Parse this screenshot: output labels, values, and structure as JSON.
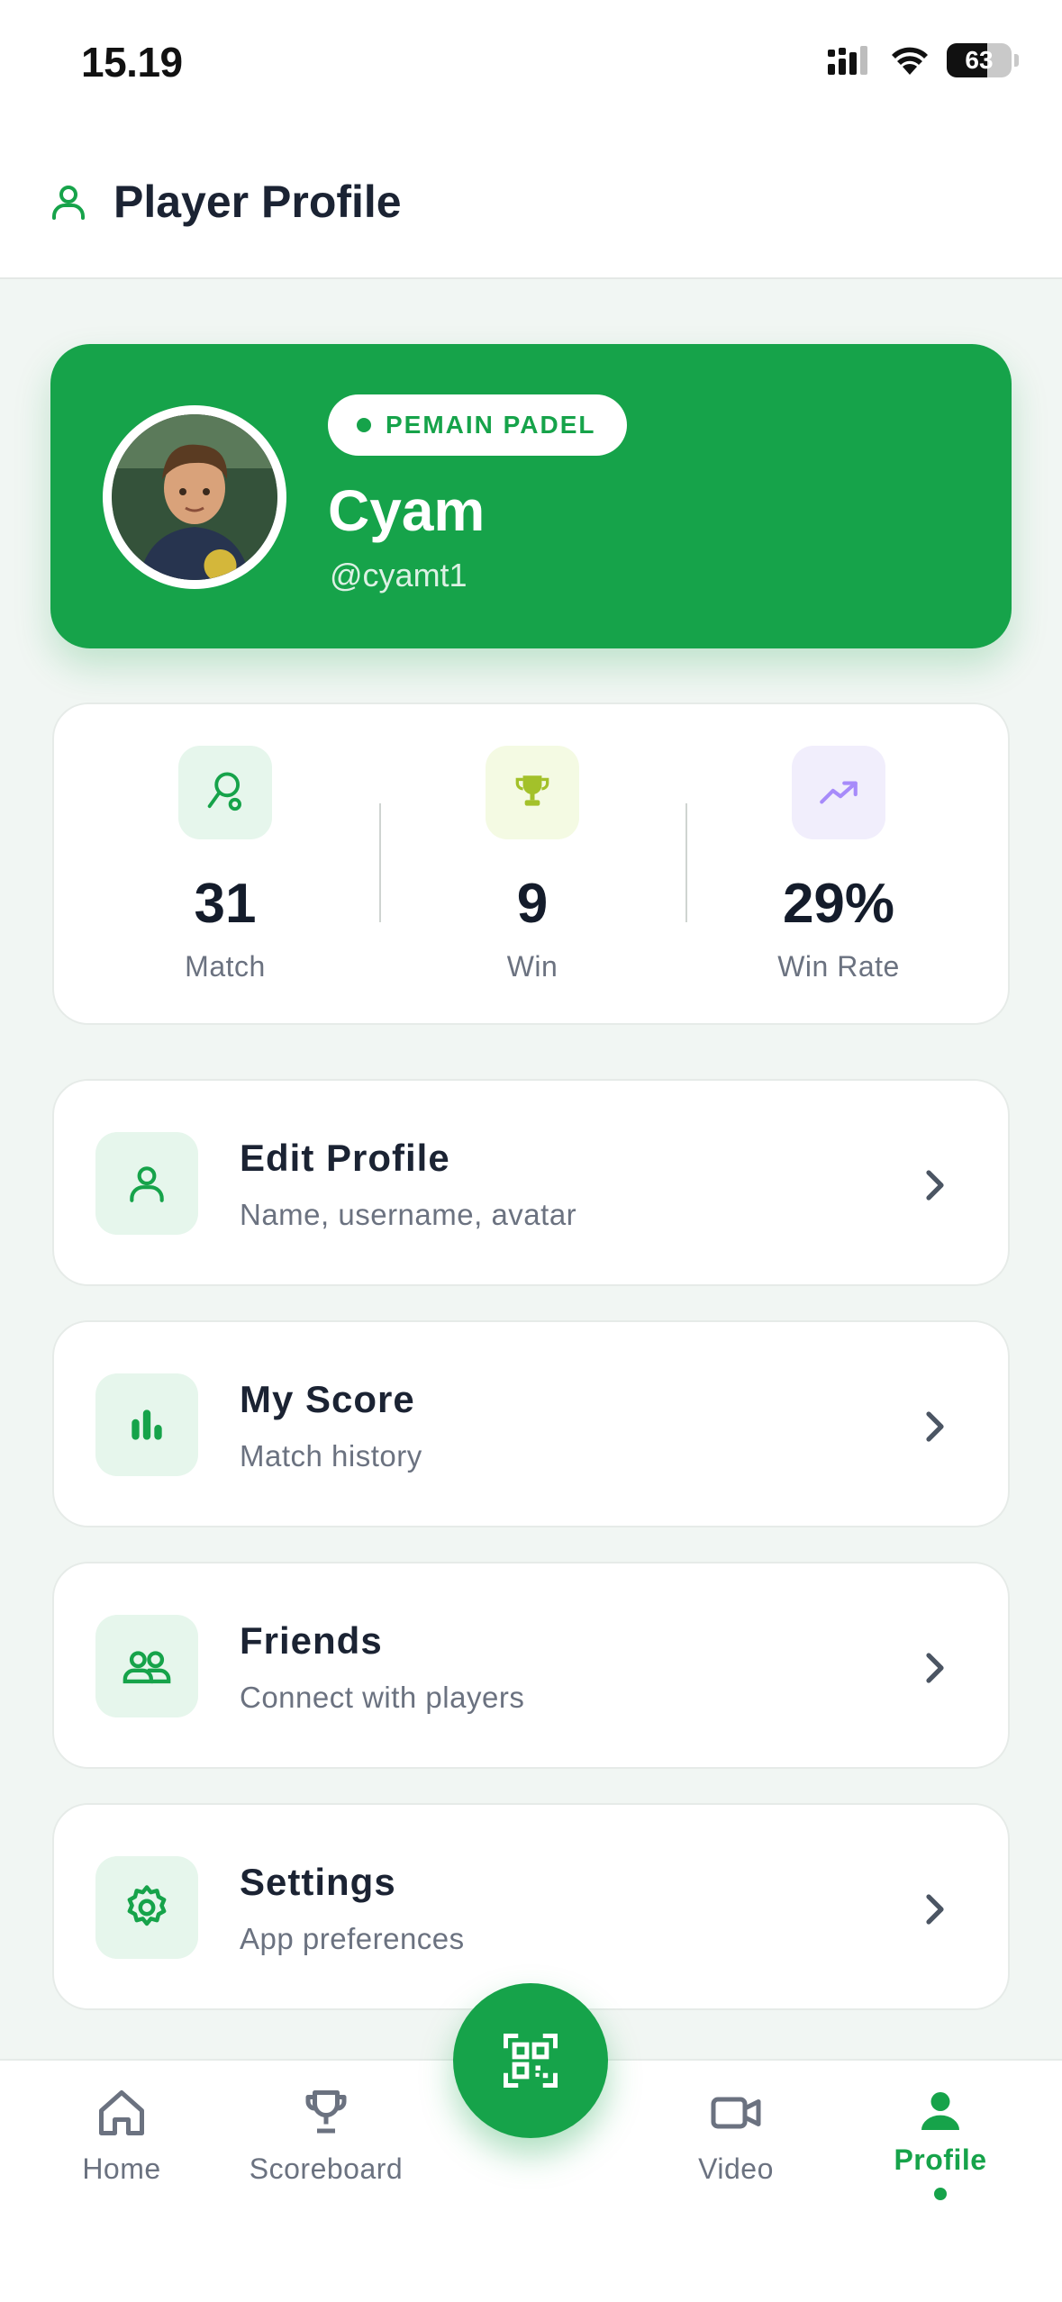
{
  "status_bar": {
    "time": "15.19",
    "battery_level": 63,
    "battery_text": "63"
  },
  "header": {
    "title": "Player Profile",
    "icon": "user-icon"
  },
  "profile": {
    "badge": "PEMAIN PADEL",
    "name": "Cyam",
    "username": "@cyamt1"
  },
  "stats": [
    {
      "icon": "racket-icon",
      "value": "31",
      "label": "Match",
      "icon_bg": "#e6f6ec",
      "icon_color": "#16a34a"
    },
    {
      "icon": "trophy-icon",
      "value": "9",
      "label": "Win",
      "icon_bg": "#f4fae3",
      "icon_color": "#a3c12a"
    },
    {
      "icon": "trend-up-icon",
      "value": "29%",
      "label": "Win Rate",
      "icon_bg": "#f1eefc",
      "icon_color": "#a78bfa"
    }
  ],
  "menu": [
    {
      "icon": "user-icon",
      "title": "Edit Profile",
      "subtitle": "Name, username, avatar"
    },
    {
      "icon": "bar-chart-icon",
      "title": "My Score",
      "subtitle": "Match history"
    },
    {
      "icon": "friends-icon",
      "title": "Friends",
      "subtitle": "Connect with players"
    },
    {
      "icon": "gear-icon",
      "title": "Settings",
      "subtitle": "App preferences"
    }
  ],
  "nav": {
    "items": [
      {
        "icon": "home-icon",
        "label": "Home",
        "active": false
      },
      {
        "icon": "trophy-icon",
        "label": "Scoreboard",
        "active": false
      },
      {
        "icon": "video-icon",
        "label": "Video",
        "active": false
      },
      {
        "icon": "profile-icon",
        "label": "Profile",
        "active": true
      }
    ],
    "fab_icon": "qr-scan-icon"
  },
  "colors": {
    "brand": "#16a34a",
    "background": "#f1f6f3",
    "text": "#1b2333",
    "muted": "#6b7280"
  }
}
